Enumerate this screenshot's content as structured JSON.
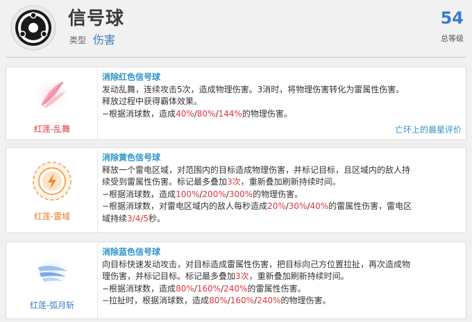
{
  "header": {
    "title": "信号球",
    "type_label": "类型",
    "type_value": "伤害",
    "level": "54",
    "level_label": "总等级"
  },
  "cards": [
    {
      "name": "红莲-乱舞",
      "name_color": "#e0353c",
      "icon": "pink-feather-icon",
      "skill_title": "消除红色信号球",
      "line1": "发动乱舞，连续攻击5次，造成物理伤害。3消时，将物理伤害转化为雷属性伤害。",
      "line2": "释放过程中获得霸体效果。",
      "l3a": "−根据消球数，造成",
      "l3v1": "40%",
      "l3s1": "/",
      "l3v2": "80%",
      "l3s2": "/",
      "l3v3": "144%",
      "l3b": "的物理伤害。",
      "link": "亡环上的晨星评价"
    },
    {
      "name": "红莲-雷域",
      "name_color": "#e67d2a",
      "icon": "lightning-gear-icon",
      "skill_title": "消除黄色信号球",
      "line1": "释放一个雷电区域，对范围内的目标造成物理伤害，并标记目标，且区域内的敌人持",
      "line2a": "续受到雷属性伤害。标记最多叠加",
      "line2v": "3次",
      "line2b": "，重新叠加刷新持续时间。",
      "l3a": "−根据消球数，造成",
      "l3v1": "100%",
      "l3s1": "/",
      "l3v2": "200%",
      "l3s2": "/",
      "l3v3": "300%",
      "l3b": "的物理伤害。",
      "l4a": "−根据消球数，对雷电区域内的敌人每秒造成",
      "l4v1": "20%",
      "l4s1": "/",
      "l4v2": "30%",
      "l4s2": "/",
      "l4v3": "40%",
      "l4b": "的雷属性伤害，雷电区",
      "l5a": "域持续",
      "l5v": "3/4/5",
      "l5b": "秒。"
    },
    {
      "name": "红莲-弧月斩",
      "name_color": "#3a7bc8",
      "icon": "blue-crescent-slash-icon",
      "skill_title": "消除蓝色信号球",
      "line1": "向目标快速发动攻击，对目标造成雷属性伤害，把目标向己方位置拉扯，再次造成物",
      "line2a": "理伤害，并标记目标。标记最多叠加",
      "line2v": "3次",
      "line2b": "，重新叠加刷新持续时间。",
      "l3a": "−根据消球数，造成",
      "l3v1": "80%",
      "l3s1": "/",
      "l3v2": "160%",
      "l3s2": "/",
      "l3v3": "240%",
      "l3b": "的雷属性伤害。",
      "l4a": "−拉扯时，根据消球数，造成",
      "l4v1": "80%",
      "l4s1": "/",
      "l4v2": "160%",
      "l4s2": "/",
      "l4v3": "240%",
      "l4b": "的物理伤害。"
    }
  ]
}
